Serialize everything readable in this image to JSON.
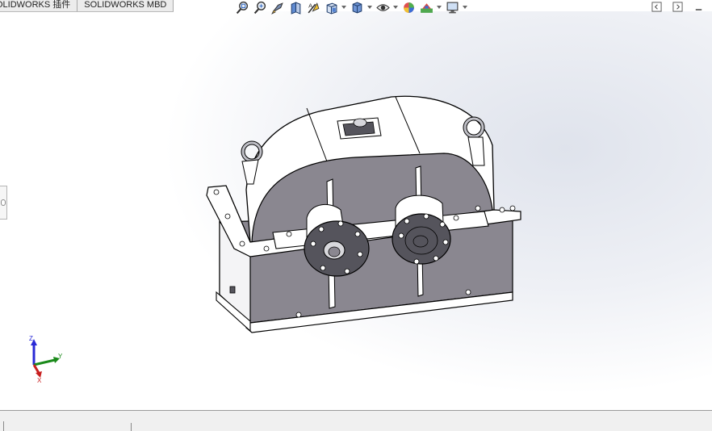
{
  "tabs": [
    {
      "label": "OLIDWORKS 插件"
    },
    {
      "label": "SOLIDWORKS MBD"
    }
  ],
  "heads_up_toolbar": [
    {
      "icon": "zoom-to-fit-icon"
    },
    {
      "icon": "zoom-to-area-icon"
    },
    {
      "icon": "previous-view-icon"
    },
    {
      "icon": "section-view-icon"
    },
    {
      "icon": "dynamic-annotation-views-icon"
    },
    {
      "icon": "view-orientation-icon"
    },
    {
      "icon": "display-style-icon"
    },
    {
      "icon": "hide-show-items-icon"
    },
    {
      "icon": "edit-appearance-icon"
    },
    {
      "icon": "apply-scene-icon"
    },
    {
      "icon": "view-settings-icon"
    }
  ],
  "window_controls": [
    "tile-left-icon",
    "tile-right-icon",
    "minimize-icon"
  ],
  "triad": {
    "x": "Y",
    "y": "Z",
    "z": "X"
  },
  "colors": {
    "housing_face": "#8a8790",
    "housing_light": "#ffffff",
    "outline": "#000000",
    "flange": "#55545c",
    "triad_x": "#1a8a1a",
    "triad_y": "#2a2ad6",
    "triad_z": "#c81e1e"
  }
}
